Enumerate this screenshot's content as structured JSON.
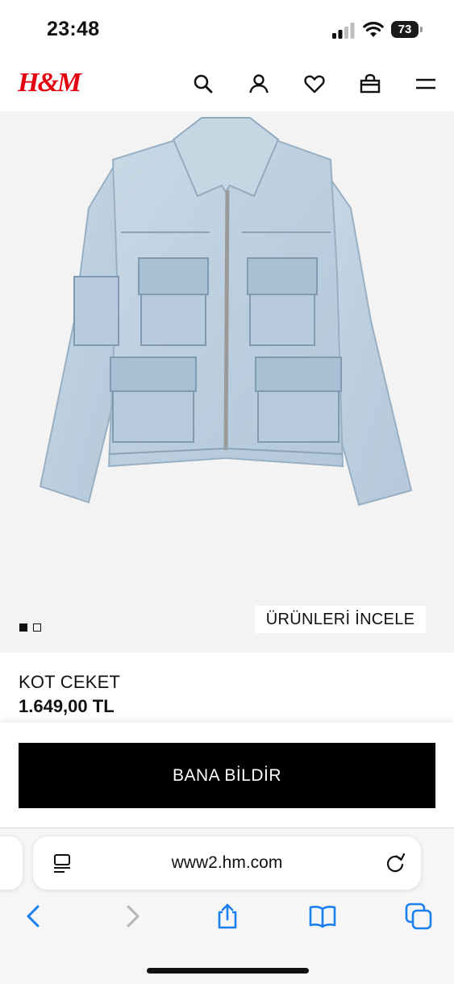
{
  "status_bar": {
    "time": "23:48",
    "battery": "73"
  },
  "header": {
    "brand": "H&M",
    "brand_color": "#e50010",
    "icons": [
      "search-icon",
      "account-icon",
      "favorites-icon",
      "shopping-bag-icon",
      "menu-icon"
    ]
  },
  "gallery": {
    "inspect_label": "ÜRÜNLERİ İNCELE",
    "image_count": 2,
    "active_index": 0
  },
  "product": {
    "name": "KOT CEKET",
    "price": "1.649,00 TL"
  },
  "cta": {
    "notify_label": "BANA BİLDİR"
  },
  "browser": {
    "url": "www2.hm.com",
    "icons": [
      "back-icon",
      "forward-icon",
      "share-icon",
      "bookmarks-icon",
      "tabs-icon"
    ],
    "accent": "#1a7ff0"
  }
}
